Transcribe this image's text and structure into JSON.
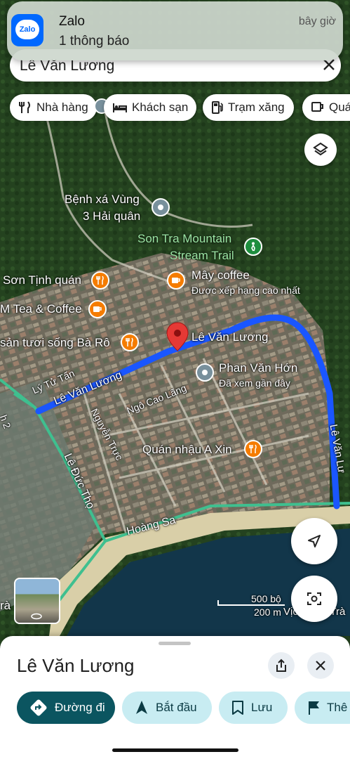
{
  "notification": {
    "app_name": "Zalo",
    "message": "1 thông báo",
    "time": "bây giờ",
    "icon_text": "Zalo"
  },
  "search": {
    "query": "Lê Văn Lương",
    "clear_icon": "close-icon"
  },
  "categories": [
    {
      "label": "Nhà hàng",
      "icon": "restaurant-icon"
    },
    {
      "label": "Khách sạn",
      "icon": "hotel-icon"
    },
    {
      "label": "Trạm xăng",
      "icon": "gas-station-icon"
    },
    {
      "label": "Quá",
      "icon": "cafe-icon"
    }
  ],
  "map": {
    "places": {
      "benh_xa_line1": "Bệnh xá Vùng",
      "benh_xa_line2": "3 Hải quân",
      "son_tra_line1": "Son Tra Mountain",
      "son_tra_line2": "Stream Trail",
      "son_tinh": "Sơn Tịnh quán",
      "may_coffee": "Mây coffee",
      "may_coffee_note": "Được xếp hạng cao nhất",
      "m_tea": "M Tea & Coffee",
      "ba_ro": "sản tươi sống Bà Rô",
      "le_van_luong_pin": "Lê Văn Lương",
      "phan_van_hon": "Phan Văn Hớn",
      "phan_van_hon_note": "Đã xem gần đây",
      "quan_nhau": "Quán nhậu A Xin",
      "vi_ch": "Vịch...em Trà",
      "left_edge": "rà"
    },
    "streets": {
      "ly_tu_tan": "Lý Tử Tấn",
      "le_van_luong": "Lê Văn Lương",
      "le_van_luong_right": "Lê Văn Lư",
      "ngo_cao_lang": "Ngô Cao Lãng",
      "nguyen_truc": "Nguyễn Trực",
      "le_duc_tho": "Lê Đức Thọ",
      "hoang_sa": "Hoàng Sa",
      "h2": "h 2"
    },
    "scale": {
      "feet": "500 bộ",
      "meters": "200 m"
    },
    "route_color": "#1a56ff"
  },
  "place_sheet": {
    "title": "Lê Văn Lương",
    "actions": [
      {
        "label": "Đường đi",
        "icon": "directions-icon",
        "primary": true
      },
      {
        "label": "Bắt đầu",
        "icon": "navigation-arrow-icon",
        "primary": false
      },
      {
        "label": "Lưu",
        "icon": "bookmark-icon",
        "primary": false
      },
      {
        "label": "Thê",
        "icon": "flag-icon",
        "primary": false
      }
    ]
  },
  "colors": {
    "primary_button": "#0b5560",
    "secondary_button": "#c8ecf2",
    "zalo_blue": "#0068ff",
    "poi_orange": "#f57c00"
  }
}
